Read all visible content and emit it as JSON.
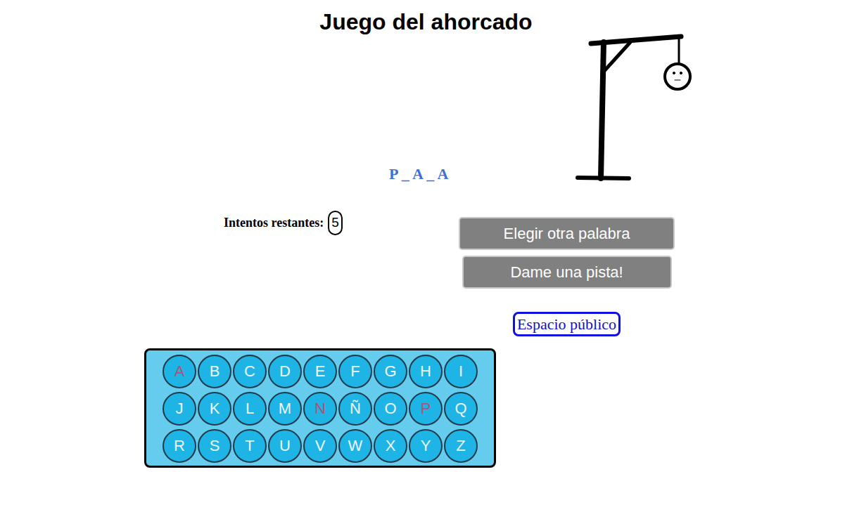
{
  "title": "Juego del ahorcado",
  "word": "P _ A _ A",
  "attempts": {
    "label": "Intentos restantes:",
    "value": "5"
  },
  "buttons": [
    "Elegir otra palabra",
    "Dame una pista!"
  ],
  "link": "Espacio público",
  "keyboard": [
    {
      "letter": "A",
      "used": true
    },
    {
      "letter": "B",
      "used": false
    },
    {
      "letter": "C",
      "used": false
    },
    {
      "letter": "D",
      "used": false
    },
    {
      "letter": "E",
      "used": false
    },
    {
      "letter": "F",
      "used": false
    },
    {
      "letter": "G",
      "used": false
    },
    {
      "letter": "H",
      "used": false
    },
    {
      "letter": "I",
      "used": false
    },
    {
      "letter": "J",
      "used": false
    },
    {
      "letter": "K",
      "used": false
    },
    {
      "letter": "L",
      "used": false
    },
    {
      "letter": "M",
      "used": false
    },
    {
      "letter": "N",
      "used": true
    },
    {
      "letter": "Ñ",
      "used": false
    },
    {
      "letter": "O",
      "used": false
    },
    {
      "letter": "P",
      "used": true
    },
    {
      "letter": "Q",
      "used": false
    },
    {
      "letter": "R",
      "used": false
    },
    {
      "letter": "S",
      "used": false
    },
    {
      "letter": "T",
      "used": false
    },
    {
      "letter": "U",
      "used": false
    },
    {
      "letter": "V",
      "used": false
    },
    {
      "letter": "W",
      "used": false
    },
    {
      "letter": "X",
      "used": false
    },
    {
      "letter": "Y",
      "used": false
    },
    {
      "letter": "Z",
      "used": false
    }
  ]
}
